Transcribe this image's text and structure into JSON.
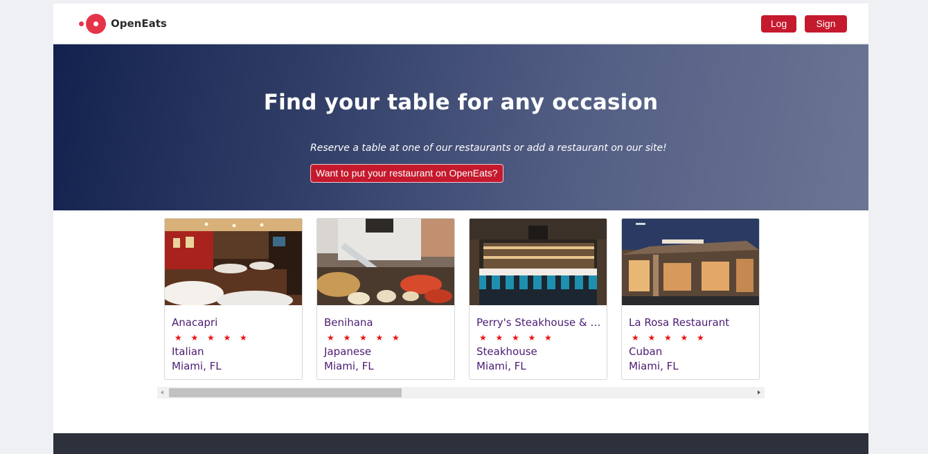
{
  "brand": {
    "name": "OpenEats",
    "accent": "#e5344a"
  },
  "nav": {
    "login_label": "Log In",
    "signup_label": "Sign Up"
  },
  "hero": {
    "title": "Find your table for any occasion",
    "subtitle": "Reserve a table at one of our restaurants or add a restaurant on our site!",
    "cta_label": "Want to put your restaurant on OpenEats?"
  },
  "restaurants": [
    {
      "name": "Anacapri",
      "rating": 5,
      "stars": "★★★★★",
      "cuisine": "Italian",
      "location": "Miami, FL",
      "image": "dining-room-photo"
    },
    {
      "name": "Benihana",
      "rating": 5,
      "stars": "★★★★★",
      "cuisine": "Japanese",
      "location": "Miami, FL",
      "image": "teppanyaki-grill-photo"
    },
    {
      "name": "Perry's Steakhouse & G...",
      "rating": 5,
      "stars": "★★★★★",
      "cuisine": "Steakhouse",
      "location": "Miami, FL",
      "image": "bar-interior-photo"
    },
    {
      "name": "La Rosa Restaurant",
      "rating": 5,
      "stars": "★★★★★",
      "cuisine": "Cuban",
      "location": "Miami, FL",
      "image": "restaurant-exterior-photo"
    }
  ],
  "scroll": {
    "position_fraction": 0.0
  },
  "colors": {
    "primary_button": "#c5192d",
    "link_text": "#4b1c72",
    "star": "#ee1010",
    "footer": "#2c313b"
  }
}
